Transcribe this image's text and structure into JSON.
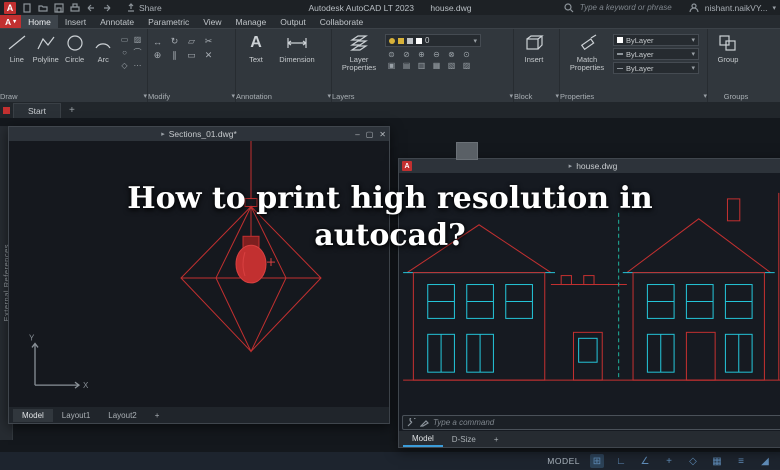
{
  "titlebar": {
    "logo": "A",
    "share_label": "Share",
    "app_title": "Autodesk AutoCAD LT 2023",
    "doc_title": "house.dwg",
    "search_placeholder": "Type a keyword or phrase",
    "user_name": "nishant.naikVY...",
    "caret": "▾"
  },
  "ribbon_tabs": {
    "app_button": "A",
    "dropdown_caret": "▾",
    "tabs": [
      {
        "label": "Home"
      },
      {
        "label": "Insert"
      },
      {
        "label": "Annotate"
      },
      {
        "label": "Parametric"
      },
      {
        "label": "View"
      },
      {
        "label": "Manage"
      },
      {
        "label": "Output"
      },
      {
        "label": "Collaborate"
      }
    ]
  },
  "ribbon": {
    "draw": {
      "label": "Draw",
      "caret": "▾",
      "tools": [
        {
          "label": "Line"
        },
        {
          "label": "Polyline"
        },
        {
          "label": "Circle"
        },
        {
          "label": "Arc"
        }
      ],
      "mini_icons": [
        "▭",
        "▨",
        "○",
        "⌒",
        "◇",
        "⋯"
      ]
    },
    "modify": {
      "label": "Modify",
      "caret": "▾",
      "mini_icons": [
        "↔",
        "↻",
        "▱",
        "✂",
        "⊕",
        "∥",
        "▭",
        "✕"
      ]
    },
    "annotation": {
      "label": "Annotation",
      "caret": "▾",
      "tools": [
        {
          "label": "Text",
          "icon": "A"
        },
        {
          "label": "Dimension"
        }
      ]
    },
    "layers": {
      "label": "Layers",
      "caret": "▾",
      "big_tool": "Layer Properties",
      "current_layer": "0",
      "mini_icons": [
        "⊜",
        "⊘",
        "⊕",
        "⊖",
        "⊗",
        "⊙",
        "▣",
        "▤",
        "▥",
        "▦",
        "▧",
        "▨"
      ]
    },
    "block": {
      "label": "Block",
      "caret": "▾",
      "tools": [
        {
          "label": "Insert"
        }
      ]
    },
    "properties": {
      "label": "Properties",
      "caret": "▾",
      "big_tool": "Match Properties",
      "dropdowns": [
        {
          "value": "ByLayer"
        },
        {
          "value": "ByLayer"
        },
        {
          "value": "ByLayer"
        }
      ]
    },
    "groups": {
      "label": "Groups",
      "tools": [
        {
          "label": "Group"
        }
      ]
    }
  },
  "file_tabs": {
    "start": "Start",
    "new_tab": "+"
  },
  "overlay": {
    "line1": "How to print high resolution in",
    "line2": "autocad?"
  },
  "palette": {
    "vertical_label": "External References"
  },
  "left_window": {
    "marker": "▸",
    "title": "Sections_01.dwg*",
    "controls": {
      "minimize": "–",
      "restore": "▢",
      "close": "✕"
    },
    "tabs": [
      {
        "label": "Model"
      },
      {
        "label": "Layout1"
      },
      {
        "label": "Layout2"
      }
    ],
    "new_layout": "+",
    "ucs": {
      "x": "X",
      "y": "Y"
    }
  },
  "right_window": {
    "marker": "▸",
    "badge": "A",
    "title": "house.dwg",
    "command_prompt": "Type a command",
    "tabs": [
      {
        "label": "Model"
      },
      {
        "label": "D-Size"
      }
    ],
    "new_layout": "+"
  },
  "statusbar": {
    "model_label": "MODEL",
    "icons": [
      "⊞",
      "∟",
      "∠",
      "+",
      "◇",
      "▦",
      "≡",
      "◢"
    ]
  },
  "colors": {
    "red": "#c23030",
    "cyan": "#24c4d8",
    "teal": "#1fae9a",
    "yellow": "#d8b23a",
    "blue": "#4a90d9"
  }
}
